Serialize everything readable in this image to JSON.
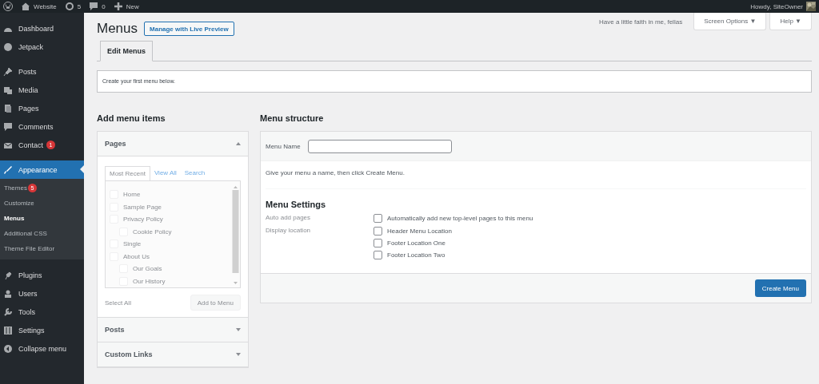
{
  "admin_bar": {
    "items": [
      {
        "kind": "logo"
      },
      {
        "kind": "home",
        "label": "Website"
      },
      {
        "kind": "updates",
        "label": "5"
      },
      {
        "kind": "comments",
        "label": "0"
      },
      {
        "kind": "new",
        "label": "New"
      }
    ],
    "greeting": "Howdy, SiteOwner"
  },
  "sidebar": {
    "items": [
      {
        "label": "Dashboard",
        "selected": false
      },
      {
        "label": "Jetpack",
        "selected": false
      },
      {
        "label": "Posts",
        "selected": false
      },
      {
        "label": "Media",
        "selected": false
      },
      {
        "label": "Pages",
        "selected": false
      },
      {
        "label": "Comments",
        "selected": false
      },
      {
        "label": "Contact",
        "badge": "1",
        "selected": false
      },
      {
        "label": "Appearance",
        "selected": true,
        "children": [
          {
            "label": "Themes",
            "badge": "5",
            "selected": false
          },
          {
            "label": "Customize",
            "selected": false
          },
          {
            "label": "Menus",
            "selected": true
          },
          {
            "label": "Additional CSS",
            "selected": false
          },
          {
            "label": "Theme File Editor",
            "selected": false
          }
        ]
      },
      {
        "label": "Plugins",
        "selected": false
      },
      {
        "label": "Users",
        "selected": false
      },
      {
        "label": "Tools",
        "selected": false
      },
      {
        "label": "Settings",
        "selected": false
      },
      {
        "label": "Collapse menu",
        "selected": false
      }
    ]
  },
  "header": {
    "quote": "Have a little faith in me, fellas",
    "buttons": [
      "Screen Options ▼",
      "Help ▼"
    ]
  },
  "title": "Menus",
  "live_preview": "Manage with Live Preview",
  "tabs": [
    {
      "label": "Edit Menus",
      "selected": true
    }
  ],
  "notice": "Create your first menu below.",
  "add_items": {
    "heading": "Add menu items",
    "sections": [
      {
        "title": "Pages",
        "expanded": true,
        "tabs": [
          {
            "label": "Most Recent",
            "selected": true
          },
          {
            "label": "View All",
            "selected": false
          },
          {
            "label": "Search",
            "selected": false
          }
        ],
        "pages": [
          {
            "label": "Home",
            "checked": false
          },
          {
            "label": "Sample Page",
            "checked": false
          },
          {
            "label": "Privacy Policy",
            "checked": false,
            "children": [
              {
                "label": "Cookie Policy",
                "checked": false
              }
            ]
          },
          {
            "label": "Single",
            "checked": false
          },
          {
            "label": "About Us",
            "checked": false,
            "children": [
              {
                "label": "Our Goals",
                "checked": false
              },
              {
                "label": "Our History",
                "checked": false
              }
            ]
          }
        ],
        "select_all": "Select All",
        "add_button": {
          "label": "Add to Menu",
          "disabled": true
        }
      },
      {
        "title": "Posts",
        "expanded": false
      },
      {
        "title": "Custom Links",
        "expanded": false
      }
    ]
  },
  "structure": {
    "heading": "Menu structure",
    "name_label": "Menu Name",
    "hint": "Give your menu a name, then click Create Menu.",
    "settings_heading": "Menu Settings",
    "settings": [
      {
        "label": "Auto add pages",
        "options": [
          {
            "label": "Automatically add new top-level pages to this menu",
            "checked": false
          }
        ]
      },
      {
        "label": "Display location",
        "options": [
          {
            "label": "Header Menu Location",
            "checked": false
          },
          {
            "label": "Footer Location One",
            "checked": false
          },
          {
            "label": "Footer Location Two",
            "checked": false
          }
        ]
      }
    ],
    "create_button": "Create Menu"
  }
}
